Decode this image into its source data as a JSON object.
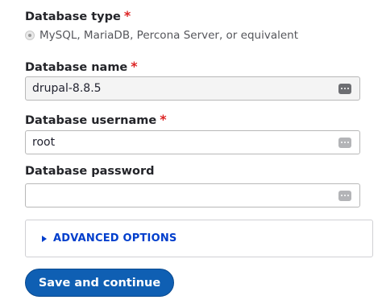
{
  "database_type": {
    "label": "Database type",
    "required_mark": "*",
    "option_label": "MySQL, MariaDB, Percona Server, or equivalent"
  },
  "database_name": {
    "label": "Database name",
    "required_mark": "*",
    "value": "drupal-8.8.5",
    "icon": "password-manager-key-icon"
  },
  "database_username": {
    "label": "Database username",
    "required_mark": "*",
    "value": "root",
    "icon": "password-manager-key-icon"
  },
  "database_password": {
    "label": "Database password",
    "value": "",
    "icon": "password-manager-key-icon"
  },
  "advanced": {
    "label": "ADVANCED OPTIONS",
    "icon": "triangle-right-icon"
  },
  "submit": {
    "label": "Save and continue"
  },
  "colors": {
    "required": "#dc2323",
    "link": "#003ecc",
    "button": "#0f5fb3"
  }
}
